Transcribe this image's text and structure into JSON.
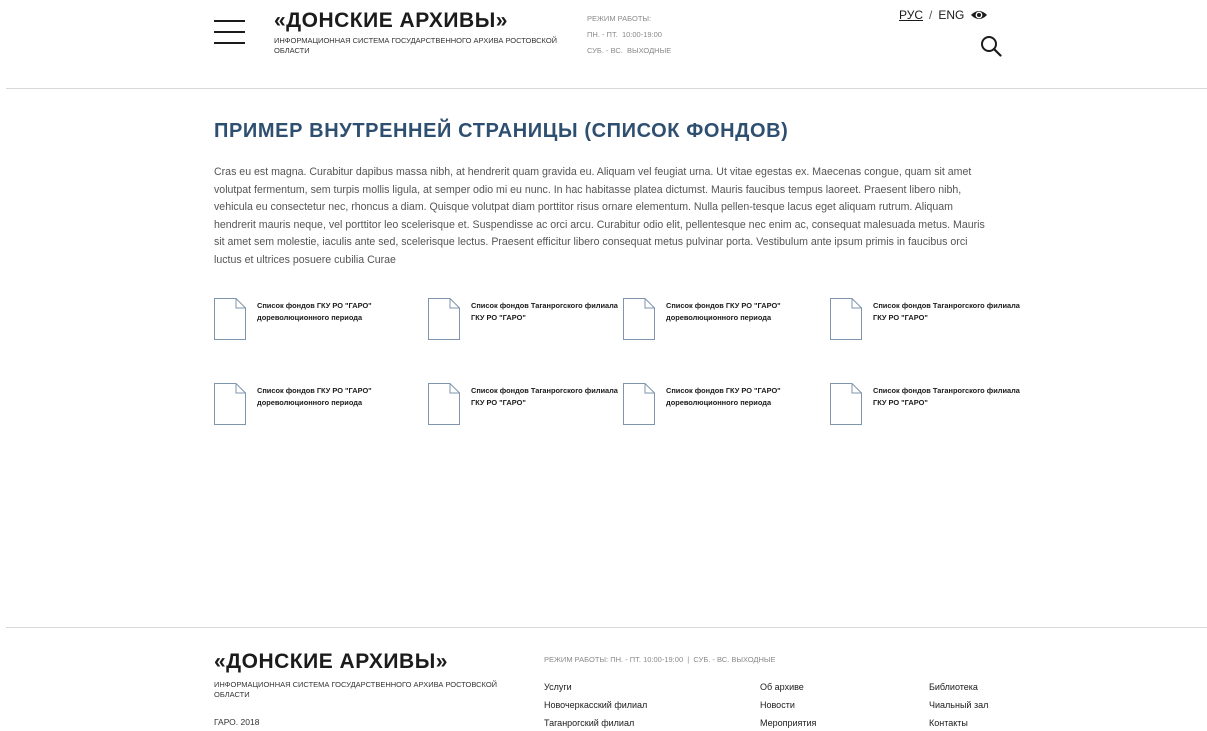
{
  "header": {
    "logo_title": "«ДОНСКИЕ АРХИВЫ»",
    "logo_subtitle": "ИНФОРМАЦИОННАЯ СИСТЕМА ГОСУДАРСТВЕННОГО АРХИВА РОСТОВСКОЙ ОБЛАСТИ",
    "hours_label": "РЕЖИМ РАБОТЫ:",
    "hours_weekdays": "ПН. - ПТ.  10:00-19:00",
    "hours_weekend": "СУБ. - ВС.  ВЫХОДНЫЕ",
    "lang_ru": "РУС",
    "lang_sep": "/",
    "lang_en": "ENG",
    "icons": [
      "menu-icon",
      "eye-icon",
      "search-icon"
    ]
  },
  "main": {
    "title": "ПРИМЕР ВНУТРЕННЕЙ СТРАНИЦЫ (СПИСОК ФОНДОВ)",
    "text": "Cras eu est magna. Curabitur dapibus massa nibh, at hendrerit quam gravida eu. Aliquam vel feugiat urna. Ut vitae egestas ex. Maecenas congue, quam sit amet volutpat fermentum, sem turpis mollis ligula, at semper odio mi eu nunc. In hac habitasse platea dictumst. Mauris faucibus tempus laoreet. Praesent libero nibh, vehicula eu consectetur nec, rhoncus a diam. Quisque volutpat diam porttitor risus ornare elementum. Nulla pellen-tesque lacus eget aliquam rutrum. Aliquam hendrerit mauris neque, vel porttitor leo scelerisque et. Suspendisse ac orci arcu. Curabitur odio elit, pellentesque nec enim ac, consequat malesuada metus. Mauris sit amet sem molestie, iaculis ante sed, scelerisque lectus. Praesent efficitur libero consequat metus pulvinar porta. Vestibulum ante ipsum primis in faucibus orci luctus et ultrices posuere cubilia Curae",
    "documents": [
      {
        "label": "Список фондов ГКУ РО \"ГАРО\" дореволюционного периода"
      },
      {
        "label": "Список фондов Таганрогского филиала ГКУ РО \"ГАРО\""
      },
      {
        "label": "Список фондов ГКУ РО \"ГАРО\" дореволюционного периода"
      },
      {
        "label": "Список фондов Таганрогского филиала ГКУ РО \"ГАРО\""
      },
      {
        "label": "Список фондов ГКУ РО \"ГАРО\" дореволюционного периода"
      },
      {
        "label": "Список фондов Таганрогского филиала ГКУ РО \"ГАРО\""
      },
      {
        "label": "Список фондов ГКУ РО \"ГАРО\" дореволюционного периода"
      },
      {
        "label": "Список фондов Таганрогского филиала ГКУ РО \"ГАРО\""
      }
    ]
  },
  "footer": {
    "logo_title": "«ДОНСКИЕ АРХИВЫ»",
    "logo_subtitle": "ИНФОРМАЦИОННАЯ СИСТЕМА ГОСУДАРСТВЕННОГО АРХИВА РОСТОВСКОЙ ОБЛАСТИ",
    "copyright": "ГАРО. 2018",
    "hours": "РЕЖИМ РАБОТЫ: ПН. - ПТ. 10:00-19:00  |  СУБ. - ВС. ВЫХОДНЫЕ",
    "links": {
      "col1": [
        "Услуги",
        "Новочеркасский филиал",
        "Таганрогский филиал"
      ],
      "col2": [
        "Об архиве",
        "Новости",
        "Мероприятия"
      ],
      "col3": [
        "Библиотека",
        "Чиальный зал",
        "Контакты"
      ]
    }
  }
}
